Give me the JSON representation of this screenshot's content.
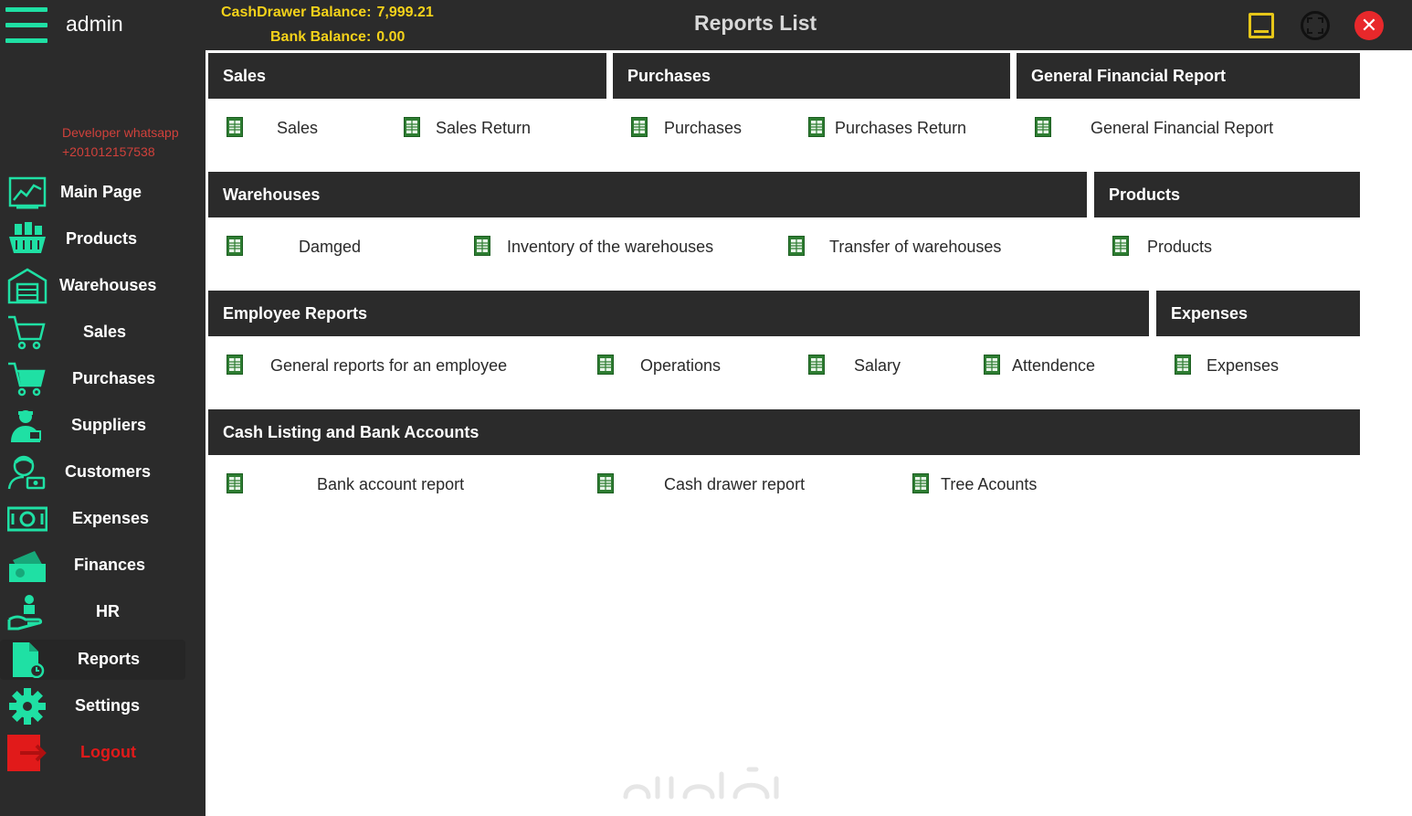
{
  "topbar": {
    "user": "admin",
    "cash_label": "CashDrawer Balance:",
    "cash_value": "7,999.21",
    "bank_label": "Bank Balance:",
    "bank_value": "0.00",
    "title": "Reports List"
  },
  "sidebar": {
    "developer_line1": "Developer whatsapp",
    "developer_line2": "+201012157538",
    "items": [
      {
        "label": "Main Page",
        "icon": "chart-board-icon"
      },
      {
        "label": "Products",
        "icon": "products-basket-icon"
      },
      {
        "label": "Warehouses",
        "icon": "warehouse-icon"
      },
      {
        "label": "Sales",
        "icon": "cart-icon"
      },
      {
        "label": "Purchases",
        "icon": "cart-full-icon"
      },
      {
        "label": "Suppliers",
        "icon": "supplier-icon"
      },
      {
        "label": "Customers",
        "icon": "customer-icon"
      },
      {
        "label": "Expenses",
        "icon": "money-icon"
      },
      {
        "label": "Finances",
        "icon": "finance-icon"
      },
      {
        "label": "HR",
        "icon": "hr-hand-icon"
      },
      {
        "label": "Reports",
        "icon": "report-doc-icon"
      },
      {
        "label": "Settings",
        "icon": "gear-icon"
      },
      {
        "label": "Logout",
        "icon": "logout-icon"
      }
    ]
  },
  "sections": {
    "sales": {
      "title": "Sales",
      "items": [
        "Sales",
        "Sales Return"
      ]
    },
    "purchases": {
      "title": "Purchases",
      "items": [
        "Purchases",
        "Purchases Return"
      ]
    },
    "general": {
      "title": "General Financial Report",
      "items": [
        "General Financial Report"
      ]
    },
    "warehouses": {
      "title": "Warehouses",
      "items": [
        "Damged",
        "Inventory of the warehouses",
        "Transfer of warehouses"
      ]
    },
    "products": {
      "title": "Products",
      "items": [
        "Products"
      ]
    },
    "employee": {
      "title": "Employee Reports",
      "items": [
        "General reports for an employee",
        "Operations",
        "Salary",
        "Attendence"
      ]
    },
    "expenses": {
      "title": "Expenses",
      "items": [
        "Expenses"
      ]
    },
    "cash": {
      "title": "Cash Listing and Bank Accounts",
      "items": [
        "Bank account report",
        "Cash drawer report",
        "Tree Acounts"
      ]
    }
  },
  "colors": {
    "accent": "#1fe0a4",
    "dark": "#2b2b2b",
    "balance": "#f4d21a",
    "close": "#e8282b",
    "doc": "#2e7d32"
  }
}
